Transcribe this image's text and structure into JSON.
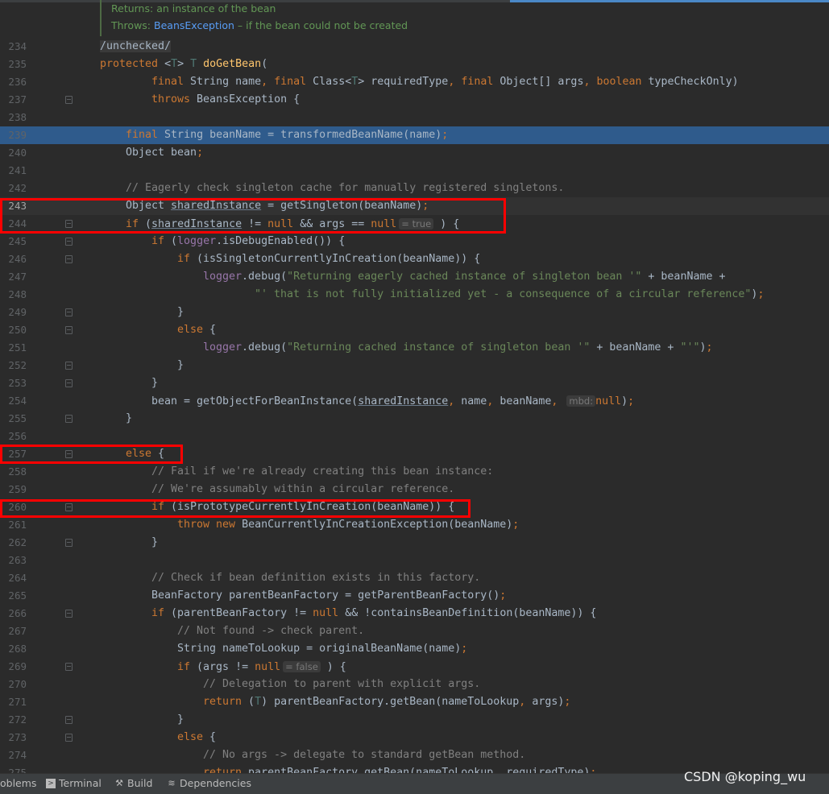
{
  "doc": {
    "returns_label": "Returns:",
    "returns_text": "an instance of the bean",
    "throws_label": "Throws:",
    "throws_link": "BeansException",
    "throws_text": " – if the bean could not be created"
  },
  "colors": {
    "highlight": "#2f5b8c",
    "keyword": "#cc7832",
    "string": "#6a8759",
    "comment": "#808080",
    "annotation_box": "#ff0000"
  },
  "lines": [
    {
      "n": "234",
      "i": 0,
      "t": [
        [
          "a",
          "/unchecked/"
        ]
      ]
    },
    {
      "n": "235",
      "i": 0,
      "t": [
        [
          "k",
          "protected "
        ],
        [
          "p",
          "<"
        ],
        [
          "t",
          "T"
        ],
        [
          "p",
          "> "
        ],
        [
          "t",
          "T "
        ],
        [
          "f",
          "doGetBean"
        ],
        [
          "p",
          "("
        ]
      ]
    },
    {
      "n": "236",
      "i": 8,
      "t": [
        [
          "k",
          "final "
        ],
        [
          "p",
          "String name"
        ],
        [
          "o",
          ", "
        ],
        [
          "k",
          "final "
        ],
        [
          "p",
          "Class<"
        ],
        [
          "t",
          "T"
        ],
        [
          "p",
          "> requiredType"
        ],
        [
          "o",
          ", "
        ],
        [
          "k",
          "final "
        ],
        [
          "p",
          "Object[] args"
        ],
        [
          "o",
          ", "
        ],
        [
          "k",
          "boolean "
        ],
        [
          "p",
          "typeCheckOnly)"
        ]
      ]
    },
    {
      "n": "237",
      "i": 8,
      "fold": true,
      "t": [
        [
          "k",
          "throws "
        ],
        [
          "p",
          "BeansException {"
        ]
      ]
    },
    {
      "n": "238",
      "i": 0,
      "t": []
    },
    {
      "n": "239",
      "i": 4,
      "hl": true,
      "t": [
        [
          "k",
          "final "
        ],
        [
          "p",
          "String beanName = transformedBeanName(name)"
        ],
        [
          "o",
          ";"
        ]
      ]
    },
    {
      "n": "240",
      "i": 4,
      "t": [
        [
          "p",
          "Object bean"
        ],
        [
          "o",
          ";"
        ]
      ]
    },
    {
      "n": "241",
      "i": 0,
      "t": []
    },
    {
      "n": "242",
      "i": 4,
      "t": [
        [
          "c",
          "// Eagerly check singleton cache for manually registered singletons."
        ]
      ]
    },
    {
      "n": "243",
      "i": 4,
      "cur": true,
      "t": [
        [
          "p",
          "Object "
        ],
        [
          "u",
          "sharedInstance"
        ],
        [
          "p",
          " = getSingleton(beanName)"
        ],
        [
          "o",
          ";"
        ]
      ]
    },
    {
      "n": "244",
      "i": 4,
      "fold": true,
      "t": [
        [
          "k",
          "if "
        ],
        [
          "p",
          "("
        ],
        [
          "u",
          "sharedInstance"
        ],
        [
          "p",
          " != "
        ],
        [
          "k",
          "null "
        ],
        [
          "p",
          "&& args == "
        ],
        [
          "k",
          "null"
        ],
        [
          "h",
          "= true"
        ],
        [
          "p",
          " ) {"
        ]
      ]
    },
    {
      "n": "245",
      "i": 8,
      "fold": true,
      "t": [
        [
          "k",
          "if "
        ],
        [
          "p",
          "("
        ],
        [
          "l",
          "logger"
        ],
        [
          "p",
          ".isDebugEnabled()) {"
        ]
      ]
    },
    {
      "n": "246",
      "i": 12,
      "fold": true,
      "t": [
        [
          "k",
          "if "
        ],
        [
          "p",
          "(isSingletonCurrentlyInCreation(beanName)) {"
        ]
      ]
    },
    {
      "n": "247",
      "i": 16,
      "t": [
        [
          "l",
          "logger"
        ],
        [
          "p",
          ".debug("
        ],
        [
          "s",
          "\"Returning eagerly cached instance of singleton bean '\""
        ],
        [
          "p",
          " + beanName +"
        ]
      ]
    },
    {
      "n": "248",
      "i": 24,
      "t": [
        [
          "s",
          "\"' that is not fully initialized yet - a consequence of a circular reference\""
        ],
        [
          "p",
          ")"
        ],
        [
          "o",
          ";"
        ]
      ]
    },
    {
      "n": "249",
      "i": 12,
      "fold": true,
      "t": [
        [
          "p",
          "}"
        ]
      ]
    },
    {
      "n": "250",
      "i": 12,
      "fold": true,
      "t": [
        [
          "k",
          "else "
        ],
        [
          "p",
          "{"
        ]
      ]
    },
    {
      "n": "251",
      "i": 16,
      "t": [
        [
          "l",
          "logger"
        ],
        [
          "p",
          ".debug("
        ],
        [
          "s",
          "\"Returning cached instance of singleton bean '\""
        ],
        [
          "p",
          " + beanName + "
        ],
        [
          "s",
          "\"'\""
        ],
        [
          "p",
          ")"
        ],
        [
          "o",
          ";"
        ]
      ]
    },
    {
      "n": "252",
      "i": 12,
      "fold": true,
      "t": [
        [
          "p",
          "}"
        ]
      ]
    },
    {
      "n": "253",
      "i": 8,
      "fold": true,
      "t": [
        [
          "p",
          "}"
        ]
      ]
    },
    {
      "n": "254",
      "i": 8,
      "t": [
        [
          "p",
          "bean = getObjectForBeanInstance("
        ],
        [
          "u",
          "sharedInstance"
        ],
        [
          "o",
          ", "
        ],
        [
          "p",
          "name"
        ],
        [
          "o",
          ", "
        ],
        [
          "p",
          "beanName"
        ],
        [
          "o",
          ", "
        ],
        [
          "h",
          "mbd:"
        ],
        [
          "k",
          "null"
        ],
        [
          "p",
          ")"
        ],
        [
          "o",
          ";"
        ]
      ]
    },
    {
      "n": "255",
      "i": 4,
      "fold": true,
      "t": [
        [
          "p",
          "}"
        ]
      ]
    },
    {
      "n": "256",
      "i": 0,
      "t": []
    },
    {
      "n": "257",
      "i": 4,
      "fold": true,
      "t": [
        [
          "k",
          "else "
        ],
        [
          "p",
          "{"
        ]
      ]
    },
    {
      "n": "258",
      "i": 8,
      "t": [
        [
          "c",
          "// Fail if we're already creating this bean instance:"
        ]
      ]
    },
    {
      "n": "259",
      "i": 8,
      "t": [
        [
          "c",
          "// We're assumably within a circular reference."
        ]
      ]
    },
    {
      "n": "260",
      "i": 8,
      "fold": true,
      "t": [
        [
          "k",
          "if "
        ],
        [
          "p",
          "(isPrototypeCurrentlyInCreation(beanName)) {"
        ]
      ]
    },
    {
      "n": "261",
      "i": 12,
      "t": [
        [
          "k",
          "throw new "
        ],
        [
          "p",
          "BeanCurrentlyInCreationException(beanName)"
        ],
        [
          "o",
          ";"
        ]
      ]
    },
    {
      "n": "262",
      "i": 8,
      "fold": true,
      "t": [
        [
          "p",
          "}"
        ]
      ]
    },
    {
      "n": "263",
      "i": 0,
      "t": []
    },
    {
      "n": "264",
      "i": 8,
      "t": [
        [
          "c",
          "// Check if bean definition exists in this factory."
        ]
      ]
    },
    {
      "n": "265",
      "i": 8,
      "t": [
        [
          "p",
          "BeanFactory parentBeanFactory = getParentBeanFactory()"
        ],
        [
          "o",
          ";"
        ]
      ]
    },
    {
      "n": "266",
      "i": 8,
      "fold": true,
      "t": [
        [
          "k",
          "if "
        ],
        [
          "p",
          "(parentBeanFactory != "
        ],
        [
          "k",
          "null "
        ],
        [
          "p",
          "&& !containsBeanDefinition(beanName)) {"
        ]
      ]
    },
    {
      "n": "267",
      "i": 12,
      "t": [
        [
          "c",
          "// Not found -> check parent."
        ]
      ]
    },
    {
      "n": "268",
      "i": 12,
      "t": [
        [
          "p",
          "String nameToLookup = originalBeanName(name)"
        ],
        [
          "o",
          ";"
        ]
      ]
    },
    {
      "n": "269",
      "i": 12,
      "fold": true,
      "t": [
        [
          "k",
          "if "
        ],
        [
          "p",
          "(args != "
        ],
        [
          "k",
          "null"
        ],
        [
          "h",
          "= false"
        ],
        [
          "p",
          " ) {"
        ]
      ]
    },
    {
      "n": "270",
      "i": 16,
      "t": [
        [
          "c",
          "// Delegation to parent with explicit args."
        ]
      ]
    },
    {
      "n": "271",
      "i": 16,
      "t": [
        [
          "k",
          "return "
        ],
        [
          "p",
          "("
        ],
        [
          "t",
          "T"
        ],
        [
          "p",
          ") parentBeanFactory.getBean(nameToLookup"
        ],
        [
          "o",
          ", "
        ],
        [
          "p",
          "args)"
        ],
        [
          "o",
          ";"
        ]
      ]
    },
    {
      "n": "272",
      "i": 12,
      "fold": true,
      "t": [
        [
          "p",
          "}"
        ]
      ]
    },
    {
      "n": "273",
      "i": 12,
      "fold": true,
      "t": [
        [
          "k",
          "else "
        ],
        [
          "p",
          "{"
        ]
      ]
    },
    {
      "n": "274",
      "i": 16,
      "t": [
        [
          "c",
          "// No args -> delegate to standard getBean method."
        ]
      ]
    },
    {
      "n": "275",
      "i": 16,
      "t": [
        [
          "k",
          "return "
        ],
        [
          "p",
          "parentBeanFactory.getBean(nameToLookup"
        ],
        [
          "o",
          ", "
        ],
        [
          "p",
          "requiredType)"
        ],
        [
          "o",
          ";"
        ]
      ]
    }
  ],
  "status": {
    "problems": "oblems",
    "terminal": "Terminal",
    "build": "Build",
    "dependencies": "Dependencies"
  },
  "watermark": "CSDN @koping_wu"
}
